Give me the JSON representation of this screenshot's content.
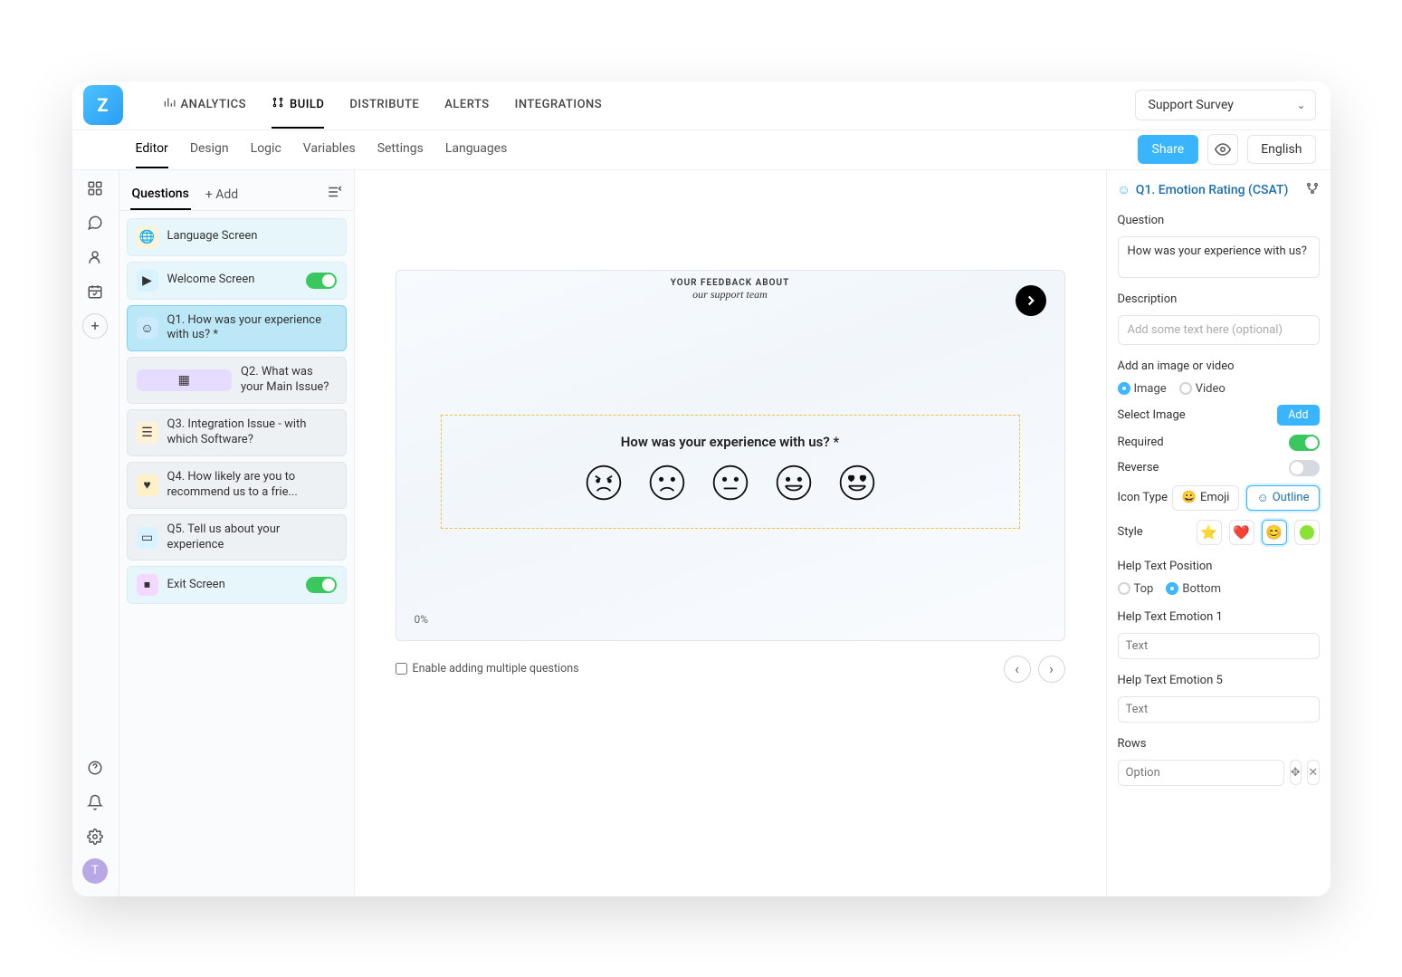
{
  "topnav": {
    "analytics": "ANALYTICS",
    "build": "BUILD",
    "distribute": "DISTRIBUTE",
    "alerts": "ALERTS",
    "integrations": "INTEGRATIONS"
  },
  "survey_select": "Support Survey",
  "subnav": {
    "editor": "Editor",
    "design": "Design",
    "logic": "Logic",
    "variables": "Variables",
    "settings": "Settings",
    "languages": "Languages"
  },
  "share": "Share",
  "language": "English",
  "qpanel": {
    "tab_questions": "Questions",
    "tab_add": "+ Add"
  },
  "questions": {
    "lang": "Language Screen",
    "welcome": "Welcome Screen",
    "q1": "Q1. How was your experience with us? *",
    "q2": "Q2. What was your Main Issue?",
    "q3": "Q3. Integration Issue - with which Software?",
    "q4": "Q4. How likely are you to recommend us to a frie...",
    "q5": "Q5. Tell us about your experience",
    "exit": "Exit Screen"
  },
  "preview": {
    "header1": "YOUR FEEDBACK ABOUT",
    "header2": "our support team",
    "question": "How was your experience with us? *",
    "progress": "0%"
  },
  "below": {
    "multi_cb": "Enable adding multiple questions"
  },
  "rpanel": {
    "title": "Q1. Emotion Rating (CSAT)",
    "question_label": "Question",
    "question_value": "How was your experience with us?",
    "description_label": "Description",
    "description_ph": "Add some text here (optional)",
    "media_label": "Add an image or video",
    "media_image": "Image",
    "media_video": "Video",
    "select_image": "Select Image",
    "add_btn": "Add",
    "required": "Required",
    "reverse": "Reverse",
    "icon_type": "Icon Type",
    "emoji": "Emoji",
    "outline": "Outline",
    "style": "Style",
    "help_pos": "Help Text Position",
    "top": "Top",
    "bottom": "Bottom",
    "help1": "Help Text Emotion 1",
    "help5": "Help Text Emotion 5",
    "text_ph": "Text",
    "rows": "Rows",
    "option_ph": "Option"
  },
  "avatar": "T"
}
